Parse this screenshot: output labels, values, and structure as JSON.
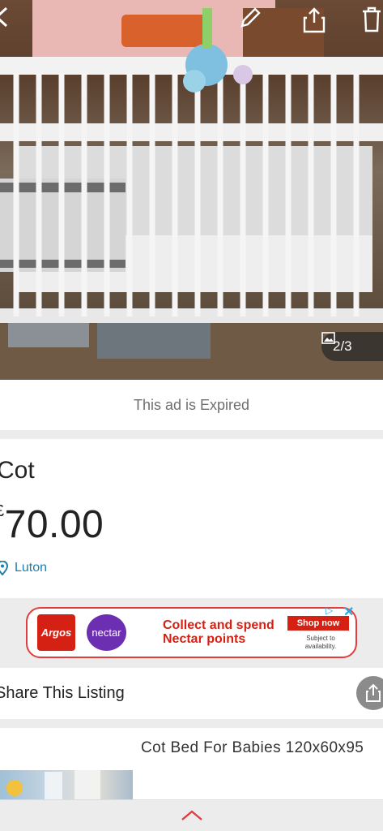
{
  "photo": {
    "counter": "2/3",
    "icons": [
      "back-arrow-icon",
      "pencil-icon",
      "share-icon",
      "trash-icon",
      "image-icon"
    ]
  },
  "status": {
    "expired_text": "This ad is Expired"
  },
  "listing": {
    "title": "Cot",
    "currency": "£",
    "price": "70.00",
    "location": "Luton"
  },
  "ad": {
    "brand1": "Argos",
    "brand2": "nectar",
    "line1": "Collect and spend",
    "line2": "Nectar points",
    "cta": "Shop now",
    "subject": "Subject to availability.",
    "colors": {
      "red": "#d42114",
      "purple": "#6c2fb2"
    }
  },
  "share": {
    "label": "Share This Listing"
  },
  "similar": {
    "title": "Cot Bed For Babies 120x60x95"
  },
  "bottom": {
    "icon": "chevron-up-icon"
  },
  "colors": {
    "link": "#1f7fa8",
    "accent": "#e23d3d"
  }
}
